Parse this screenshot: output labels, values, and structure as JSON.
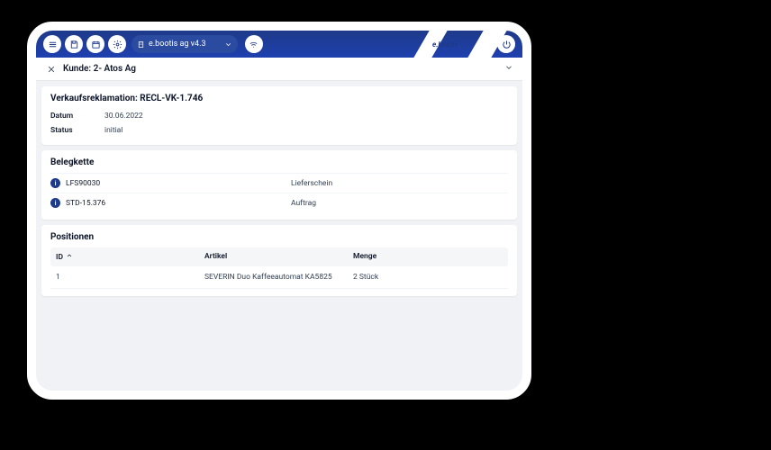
{
  "topbar": {
    "tenant_label": "e.bootis ag v4.3",
    "brand": "e.bootis"
  },
  "breadcrumb": {
    "title": "Kunde: 2- Atos Ag"
  },
  "complaint": {
    "title": "Verkaufsreklamation: RECL-VK-1.746",
    "date_label": "Datum",
    "date_value": "30.06.2022",
    "status_label": "Status",
    "status_value": "initial"
  },
  "belegkette": {
    "title": "Belegkette",
    "rows": [
      {
        "code": "LFS90030",
        "type": "Lieferschein"
      },
      {
        "code": "STD-15.376",
        "type": "Auftrag"
      }
    ]
  },
  "positionen": {
    "title": "Positionen",
    "columns": {
      "id": "ID",
      "artikel": "Artikel",
      "menge": "Menge"
    },
    "rows": [
      {
        "id": "1",
        "artikel": "SEVERIN Duo Kaffeeautomat KA5825",
        "menge": "2 Stück"
      }
    ]
  }
}
